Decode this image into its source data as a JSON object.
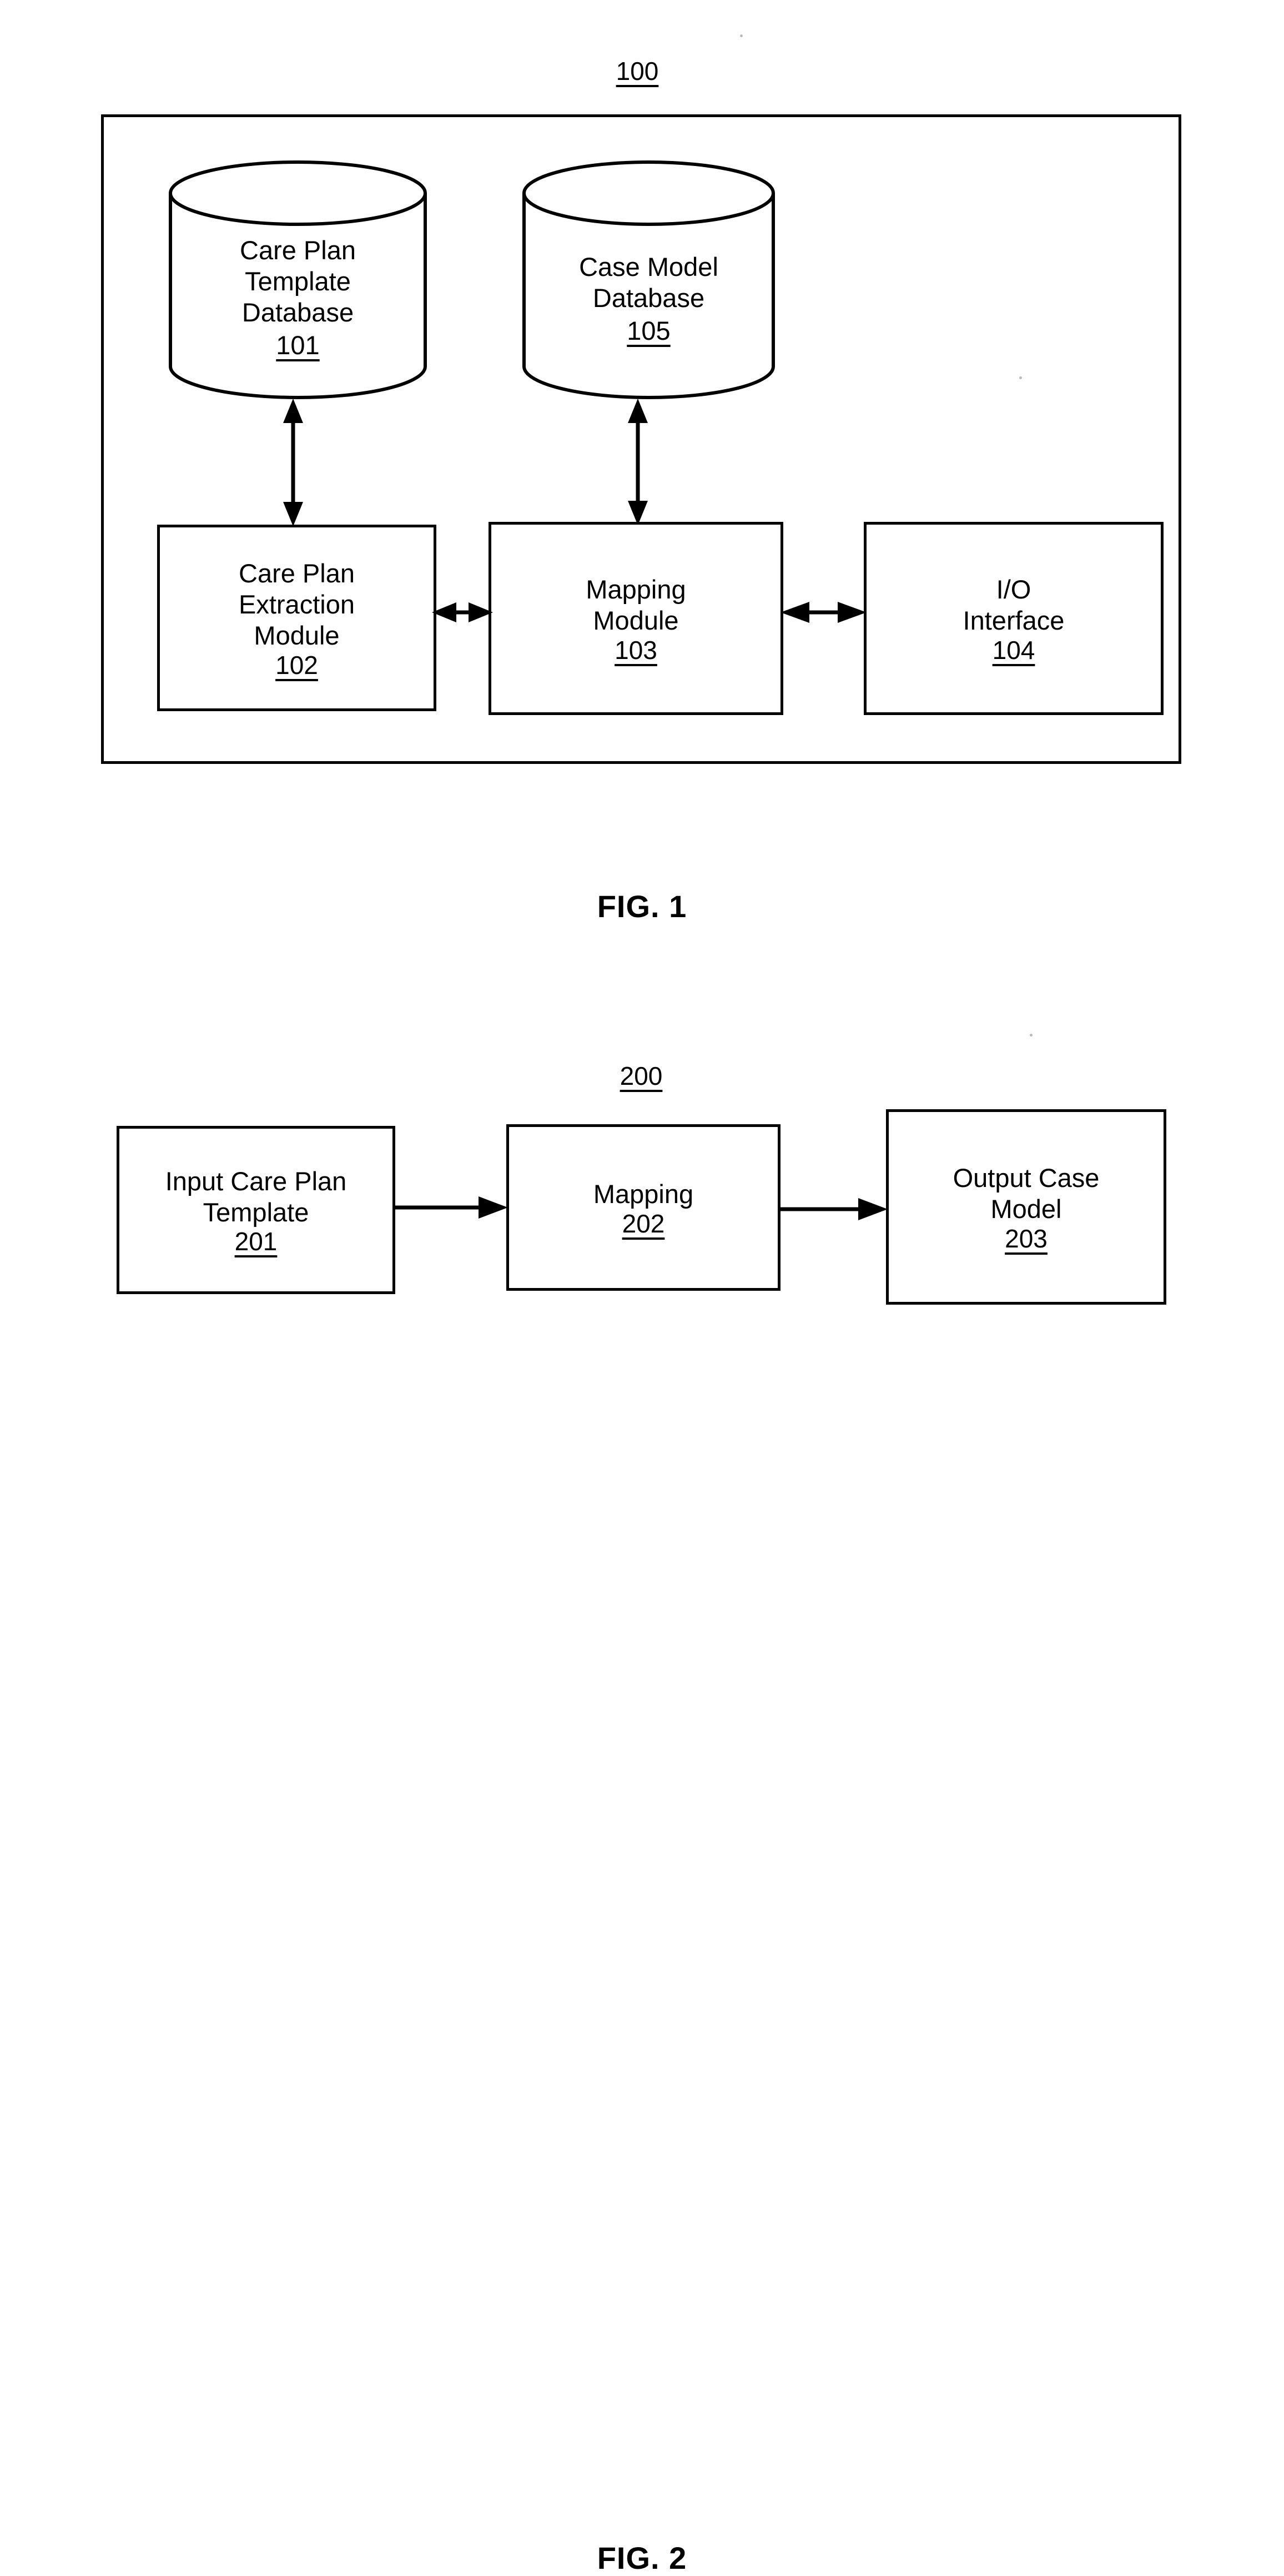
{
  "figure1": {
    "system_ref": "100",
    "caption": "FIG. 1",
    "databases": [
      {
        "name": "care-plan-template-database",
        "label": "Care Plan\nTemplate\nDatabase",
        "ref": "101"
      },
      {
        "name": "case-model-database",
        "label": "Case Model\nDatabase",
        "ref": "105"
      }
    ],
    "modules": [
      {
        "name": "care-plan-extraction-module",
        "label": "Care Plan\nExtraction\nModule",
        "ref": "102"
      },
      {
        "name": "mapping-module",
        "label": "Mapping\nModule",
        "ref": "103"
      },
      {
        "name": "io-interface",
        "label": "I/O\nInterface",
        "ref": "104"
      }
    ],
    "connectors": [
      {
        "name": "db101-to-module102",
        "type": "bidirectional",
        "orientation": "vertical"
      },
      {
        "name": "db105-to-module103",
        "type": "bidirectional",
        "orientation": "vertical"
      },
      {
        "name": "module102-to-module103",
        "type": "bidirectional",
        "orientation": "horizontal"
      },
      {
        "name": "module103-to-interface104",
        "type": "bidirectional",
        "orientation": "horizontal"
      }
    ]
  },
  "figure2": {
    "flow_ref": "200",
    "caption": "FIG. 2",
    "nodes": [
      {
        "name": "input-care-plan-template",
        "label": "Input Care Plan\nTemplate",
        "ref": "201"
      },
      {
        "name": "mapping-step",
        "label": "Mapping",
        "ref": "202"
      },
      {
        "name": "output-case-model",
        "label": "Output Case\nModel",
        "ref": "203"
      }
    ],
    "connectors": [
      {
        "name": "node201-to-node202",
        "type": "unidirectional",
        "orientation": "horizontal"
      },
      {
        "name": "node202-to-node203",
        "type": "unidirectional",
        "orientation": "horizontal"
      }
    ]
  },
  "colors": {
    "ink": "#000000",
    "paper": "#ffffff"
  }
}
